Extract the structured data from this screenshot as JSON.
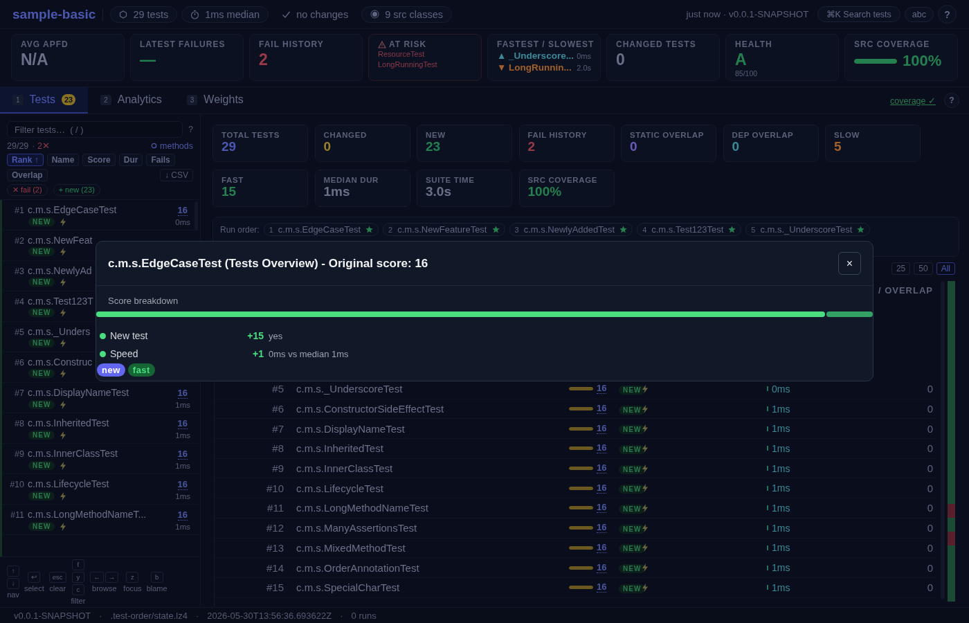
{
  "header": {
    "title": "sample-basic",
    "pills": [
      {
        "kind": "hexagon",
        "text": "29 tests",
        "outlined": true
      },
      {
        "kind": "clock",
        "text": "1ms median",
        "outlined": true
      },
      {
        "kind": "check",
        "text": "no changes",
        "outlined": false
      },
      {
        "kind": "dot",
        "text": "9 src classes",
        "outlined": true
      }
    ],
    "meta": "just now · v0.0.1-SNAPSHOT",
    "search": "⌘K Search tests",
    "font_toggle": "abc",
    "help": "?"
  },
  "metrics": [
    {
      "kind": "value",
      "label": "AVG APFD",
      "value": "N/A",
      "color": "#6a7088"
    },
    {
      "kind": "value",
      "label": "LATEST FAILURES",
      "value": "—",
      "color": "#25804f"
    },
    {
      "kind": "value",
      "label": "FAIL HISTORY",
      "value": "2",
      "color": "#9a3a48"
    },
    {
      "kind": "risk",
      "label": "AT RISK",
      "items": [
        "ResourceTest",
        "LongRunningTest"
      ]
    },
    {
      "kind": "extremes",
      "label": "FASTEST / SLOWEST",
      "items": [
        {
          "marker": "▲",
          "name": "_Underscore...",
          "time": "0ms",
          "color": "#3a8a98"
        },
        {
          "marker": "▼",
          "name": "LongRunnin...",
          "time": "2.0s",
          "color": "#a0602a"
        }
      ]
    },
    {
      "kind": "value",
      "label": "CHANGED TESTS",
      "value": "0",
      "color": "#6a7088"
    },
    {
      "kind": "health",
      "label": "HEALTH",
      "value": "A",
      "detail": "85/100",
      "color": "#25804f"
    },
    {
      "kind": "coverage",
      "label": "SRC COVERAGE",
      "value": "100%",
      "level": 1
    }
  ],
  "tabs_bar": {
    "tabs": [
      {
        "key": "1",
        "label": "Tests",
        "badge": "23",
        "selected": true
      },
      {
        "key": "2",
        "label": "Analytics",
        "selected": false
      },
      {
        "key": "3",
        "label": "Weights",
        "selected": false
      }
    ],
    "coverage_link": "coverage ✓",
    "help": "?"
  },
  "sidebar": {
    "filter": {
      "placeholder": "Filter tests…  ( / )"
    },
    "help": "?",
    "count": "29/29",
    "failures": "· 2✕",
    "methods": "methods",
    "sort": [
      {
        "label": "Rank ↑",
        "selected": true
      },
      {
        "label": "Name",
        "selected": false
      },
      {
        "label": "Score",
        "selected": false
      },
      {
        "label": "Dur",
        "selected": false
      },
      {
        "label": "Fails",
        "selected": false
      },
      {
        "label": "Overlap",
        "selected": false
      }
    ],
    "csv": "↓ CSV",
    "chips": [
      {
        "label": "✕ fail (2)",
        "color": "#9a3a48"
      },
      {
        "label": "+ new (23)",
        "color": "#25804f"
      }
    ],
    "tests": [
      {
        "rank": "#1",
        "name": "c.m.s.EdgeCaseTest",
        "score": "16",
        "badge": "NEW",
        "fast": true,
        "duration": "0ms"
      },
      {
        "rank": "#2",
        "name": "c.m.s.NewFeat",
        "badge": "NEW",
        "fast": true
      },
      {
        "rank": "#3",
        "name": "c.m.s.NewlyAd",
        "badge": "NEW",
        "fast": true
      },
      {
        "rank": "#4",
        "name": "c.m.s.Test123T",
        "badge": "NEW",
        "fast": true
      },
      {
        "rank": "#5",
        "name": "c.m.s._Unders",
        "badge": "NEW",
        "fast": true
      },
      {
        "rank": "#6",
        "name": "c.m.s.Construc",
        "badge": "NEW",
        "fast": true
      },
      {
        "rank": "#7",
        "name": "c.m.s.DisplayNameTest",
        "score": "16",
        "badge": "NEW",
        "fast": true,
        "duration": "1ms"
      },
      {
        "rank": "#8",
        "name": "c.m.s.InheritedTest",
        "score": "16",
        "badge": "NEW",
        "fast": true,
        "duration": "1ms"
      },
      {
        "rank": "#9",
        "name": "c.m.s.InnerClassTest",
        "score": "16",
        "badge": "NEW",
        "fast": true,
        "duration": "1ms"
      },
      {
        "rank": "#10",
        "name": "c.m.s.LifecycleTest",
        "score": "16",
        "badge": "NEW",
        "fast": true,
        "duration": "1ms"
      },
      {
        "rank": "#11",
        "name": "c.m.s.LongMethodNameT...",
        "score": "16",
        "badge": "NEW",
        "fast": true,
        "duration": "1ms"
      }
    ],
    "shortcuts": [
      {
        "stacked": true,
        "keys": [
          "↑",
          "↓"
        ],
        "label": "nav"
      },
      {
        "keys": [
          "↩"
        ],
        "label": "select"
      },
      {
        "keys": [
          "esc"
        ],
        "label": "clear"
      },
      {
        "stacked": true,
        "keys": [
          "f",
          "y",
          "c"
        ],
        "label": "filter"
      },
      {
        "stacked": false,
        "keys": [
          "←",
          "→"
        ],
        "label": "browse"
      },
      {
        "keys": [
          "z"
        ],
        "label": "focus"
      },
      {
        "keys": [
          "b"
        ],
        "label": "blame"
      }
    ]
  },
  "main": {
    "stats": [
      {
        "label": "TOTAL TESTS",
        "value": "29",
        "color": "#4a58b0"
      },
      {
        "label": "CHANGED",
        "value": "0",
        "color": "#9a8028"
      },
      {
        "label": "NEW",
        "value": "23",
        "color": "#25804f"
      },
      {
        "label": "FAIL HISTORY",
        "value": "2",
        "color": "#9a3a48"
      },
      {
        "label": "STATIC OVERLAP",
        "value": "0",
        "color": "#6a5ab8"
      },
      {
        "label": "DEP OVERLAP",
        "value": "0",
        "color": "#3a8a98"
      },
      {
        "label": "SLOW",
        "value": "5",
        "color": "#a0602a"
      },
      {
        "label": "FAST",
        "value": "15",
        "color": "#25804f"
      },
      {
        "label": "MEDIAN DUR",
        "value": "1ms",
        "color": "#6a7088"
      },
      {
        "label": "SUITE TIME",
        "value": "3.0s",
        "color": "#6a7088"
      },
      {
        "label": "SRC COVERAGE",
        "value": "100%",
        "color": "#25804f"
      }
    ],
    "run_order": {
      "label": "Run order:",
      "items": [
        {
          "index": "1",
          "name": "c.m.s.EdgeCaseTest"
        },
        {
          "index": "2",
          "name": "c.m.s.NewFeatureTest"
        },
        {
          "index": "3",
          "name": "c.m.s.NewlyAddedTest"
        },
        {
          "index": "4",
          "name": "c.m.s.Test123Test"
        },
        {
          "index": "5",
          "name": "c.m.s._UnderscoreTest"
        }
      ]
    },
    "table": {
      "pager": [
        {
          "label": "25",
          "selected": false
        },
        {
          "label": "50",
          "selected": false
        },
        {
          "label": "All",
          "selected": true
        }
      ],
      "overlap_heading": "/ OVERLAP",
      "rows": [
        {
          "rank": "#5",
          "name": "c.m.s._UnderscoreTest",
          "level": 1,
          "score": "16",
          "badge": "NEW",
          "fast": true,
          "duration": "0ms",
          "overlap": "0"
        },
        {
          "rank": "#6",
          "name": "c.m.s.ConstructorSideEffectTest",
          "level": 1,
          "score": "16",
          "badge": "NEW",
          "fast": true,
          "duration": "1ms",
          "overlap": "0"
        },
        {
          "rank": "#7",
          "name": "c.m.s.DisplayNameTest",
          "level": 1,
          "score": "16",
          "badge": "NEW",
          "fast": true,
          "duration": "1ms",
          "overlap": "0"
        },
        {
          "rank": "#8",
          "name": "c.m.s.InheritedTest",
          "level": 1,
          "score": "16",
          "badge": "NEW",
          "fast": true,
          "duration": "1ms",
          "overlap": "0"
        },
        {
          "rank": "#9",
          "name": "c.m.s.InnerClassTest",
          "level": 1,
          "score": "16",
          "badge": "NEW",
          "fast": true,
          "duration": "1ms",
          "overlap": "0"
        },
        {
          "rank": "#10",
          "name": "c.m.s.LifecycleTest",
          "level": 1,
          "score": "16",
          "badge": "NEW",
          "fast": true,
          "duration": "1ms",
          "overlap": "0"
        },
        {
          "rank": "#11",
          "name": "c.m.s.LongMethodNameTest",
          "level": 1,
          "score": "16",
          "badge": "NEW",
          "fast": true,
          "duration": "1ms",
          "overlap": "0"
        },
        {
          "rank": "#12",
          "name": "c.m.s.ManyAssertionsTest",
          "level": 1,
          "score": "16",
          "badge": "NEW",
          "fast": true,
          "duration": "1ms",
          "overlap": "0"
        },
        {
          "rank": "#13",
          "name": "c.m.s.MixedMethodTest",
          "level": 1,
          "score": "16",
          "badge": "NEW",
          "fast": true,
          "duration": "1ms",
          "overlap": "0"
        },
        {
          "rank": "#14",
          "name": "c.m.s.OrderAnnotationTest",
          "level": 1,
          "score": "16",
          "badge": "NEW",
          "fast": true,
          "duration": "1ms",
          "overlap": "0"
        },
        {
          "rank": "#15",
          "name": "c.m.s.SpecialCharTest",
          "level": 1,
          "score": "16",
          "badge": "NEW",
          "fast": true,
          "duration": "1ms",
          "overlap": "0"
        }
      ],
      "minimap": [
        {
          "color": "#1c4a35"
        },
        {
          "color": "#1c4a35"
        },
        {
          "color": "#1c4a35"
        },
        {
          "color": "#1c4a35"
        },
        {
          "color": "#1c4a35"
        },
        {
          "color": "#1c4a35"
        },
        {
          "color": "#1c4a35"
        },
        {
          "color": "#1c4a35"
        },
        {
          "color": "#1c4a35"
        },
        {
          "color": "#1c4a35"
        },
        {
          "color": "#1c4a35"
        },
        {
          "color": "#1c4a35"
        },
        {
          "color": "#1c4a35"
        },
        {
          "color": "#1c4a35"
        },
        {
          "color": "#1c4a35"
        },
        {
          "color": "#1c4a35"
        },
        {
          "color": "#5a1f2c"
        },
        {
          "color": "#1c4a35"
        },
        {
          "color": "#5a1f2c"
        },
        {
          "color": "#1c4a35"
        },
        {
          "color": "#1c4a35"
        },
        {
          "color": "#1c4a35"
        },
        {
          "color": "#1c4a35"
        }
      ]
    }
  },
  "status_bar": {
    "separator": "·",
    "items": [
      "v0.0.1-SNAPSHOT",
      ".test-order/state.lz4",
      "2026-05-30T13:56:36.693622Z",
      "0 runs"
    ]
  },
  "modal": {
    "title": "c.m.s.EdgeCaseTest (Tests Overview) - Original score: 16",
    "close": "×",
    "section": "Score breakdown",
    "bar": [
      {
        "level": 0.94,
        "color": "#4ade80"
      },
      {
        "level": 0.06,
        "color": "#35a265"
      }
    ],
    "rows": [
      {
        "label": "New test",
        "points": "+15",
        "detail": "yes",
        "color": "#4ade80"
      },
      {
        "label": "Speed",
        "points": "+1",
        "detail": "0ms vs median 1ms",
        "color": "#4ade80"
      }
    ],
    "tags": [
      {
        "kind": "accent",
        "label": "new",
        "color": "#6366f1"
      },
      {
        "kind": "success",
        "label": "fast",
        "color": "#166534"
      }
    ]
  }
}
